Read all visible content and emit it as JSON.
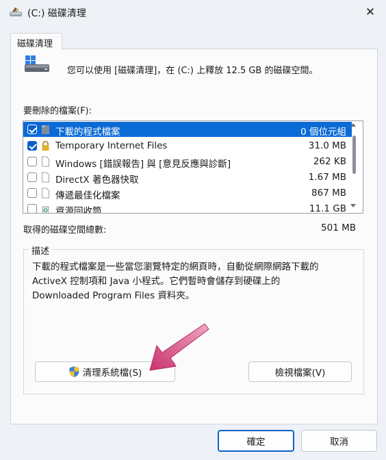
{
  "window": {
    "title": "(C:) 磁碟清理",
    "app_icon": "disk-cleanup-icon",
    "close_glyph": "✕"
  },
  "tab": {
    "label": "磁碟清理"
  },
  "intro_text": "您可以使用 [磁碟清理]，在 (C:) 上釋放 12.5 GB 的磁碟空間。",
  "files_label": "要刪除的檔案(F):",
  "files": [
    {
      "name": "下載的程式檔案",
      "size": "0 個位元組",
      "checked": true,
      "selected": true,
      "icon": "folder-icon"
    },
    {
      "name": "Temporary Internet Files",
      "size": "31.0 MB",
      "checked": true,
      "selected": false,
      "icon": "lock-icon"
    },
    {
      "name": "Windows [錯誤報告] 與 [意見反應與診斷]",
      "size": "262 KB",
      "checked": false,
      "selected": false,
      "icon": "file-icon"
    },
    {
      "name": "DirectX 著色器快取",
      "size": "1.67 MB",
      "checked": false,
      "selected": false,
      "icon": "file-icon"
    },
    {
      "name": "傳遞最佳化檔案",
      "size": "867 MB",
      "checked": false,
      "selected": false,
      "icon": "file-icon"
    },
    {
      "name": "資源回收筒",
      "size": "11.1 GB",
      "checked": false,
      "selected": false,
      "icon": "recycle-bin-icon"
    }
  ],
  "total": {
    "label": "取得的磁碟空間總數:",
    "value": "501 MB"
  },
  "description": {
    "legend": "描述",
    "lines": [
      "下載的程式檔案是一些當您瀏覽特定的網頁時，自動從網際網路下載的",
      "ActiveX 控制項和 Java 小程式。它們暫時會儲存到硬碟上的",
      "Downloaded Program Files 資料夾。"
    ]
  },
  "buttons": {
    "clean_system": "清理系統檔(S)",
    "view_files": "檢視檔案(V)",
    "ok": "確定",
    "cancel": "取消"
  },
  "colors": {
    "accent": "#0b6bd6",
    "highlight_arrow": "#d9467e"
  }
}
